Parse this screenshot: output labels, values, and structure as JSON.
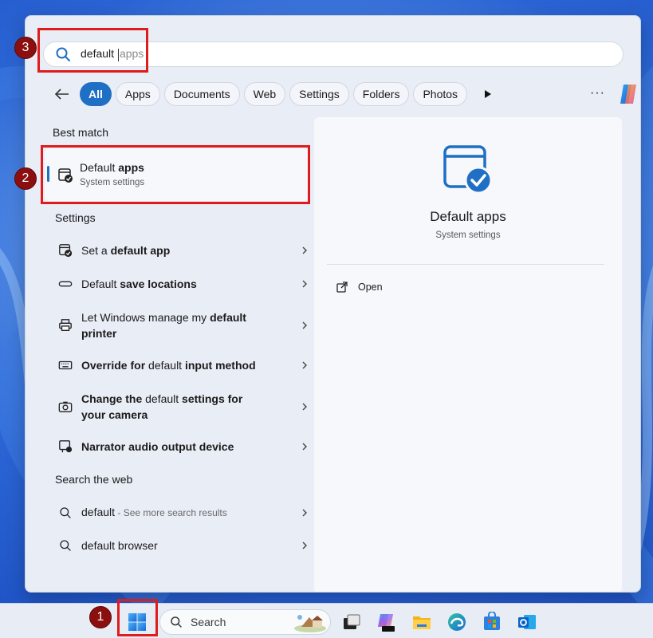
{
  "search": {
    "typed": "default",
    "ghost": "apps"
  },
  "filters": {
    "chips": [
      "All",
      "Apps",
      "Documents",
      "Web",
      "Settings",
      "Folders",
      "Photos"
    ],
    "active": "All"
  },
  "best_match": {
    "section_label": "Best match",
    "title_plain": "Default",
    "title_bold": " apps",
    "subtitle": "System settings"
  },
  "settings_section": {
    "label": "Settings",
    "items": [
      {
        "pre": "Set a ",
        "bold1": "default",
        "mid": " ",
        "bold2": "app",
        "icon": "default-apps-icon"
      },
      {
        "pre": "Default ",
        "bold1": "save locations",
        "mid": "",
        "bold2": "",
        "icon": "save-location-icon"
      },
      {
        "pre": "Let Windows manage my ",
        "bold1": "default",
        "mid": "",
        "bold2": "",
        "line2": "printer",
        "icon": "printer-icon"
      },
      {
        "pre": "Override for ",
        "bold1": "default",
        "mid": " input method",
        "bold2": "",
        "icon": "keyboard-icon"
      },
      {
        "pre": "Change the ",
        "bold1": "default",
        "mid": " settings for",
        "bold2": "",
        "line2": "your camera",
        "icon": "camera-icon"
      },
      {
        "pre": "Narrator audio output device",
        "bold1": "",
        "mid": "",
        "bold2": "",
        "icon": "narrator-icon"
      }
    ]
  },
  "web_section": {
    "label": "Search the web",
    "items": [
      {
        "text": "default",
        "hint": " - See more search results"
      },
      {
        "text": "default browser",
        "hint": ""
      }
    ]
  },
  "detail": {
    "name": "Default apps",
    "subtitle": "System settings",
    "action": "Open"
  },
  "taskbar": {
    "search_label": "Search",
    "apps": [
      "task-view-icon",
      "m365-copilot-icon",
      "file-explorer-icon",
      "edge-icon",
      "store-icon",
      "outlook-icon"
    ]
  },
  "annotations": {
    "badges": [
      "1",
      "2",
      "3"
    ]
  },
  "colors": {
    "accent": "#1f6fc4",
    "annotation_red": "#e01b1b",
    "badge": "#8b0f0f"
  }
}
